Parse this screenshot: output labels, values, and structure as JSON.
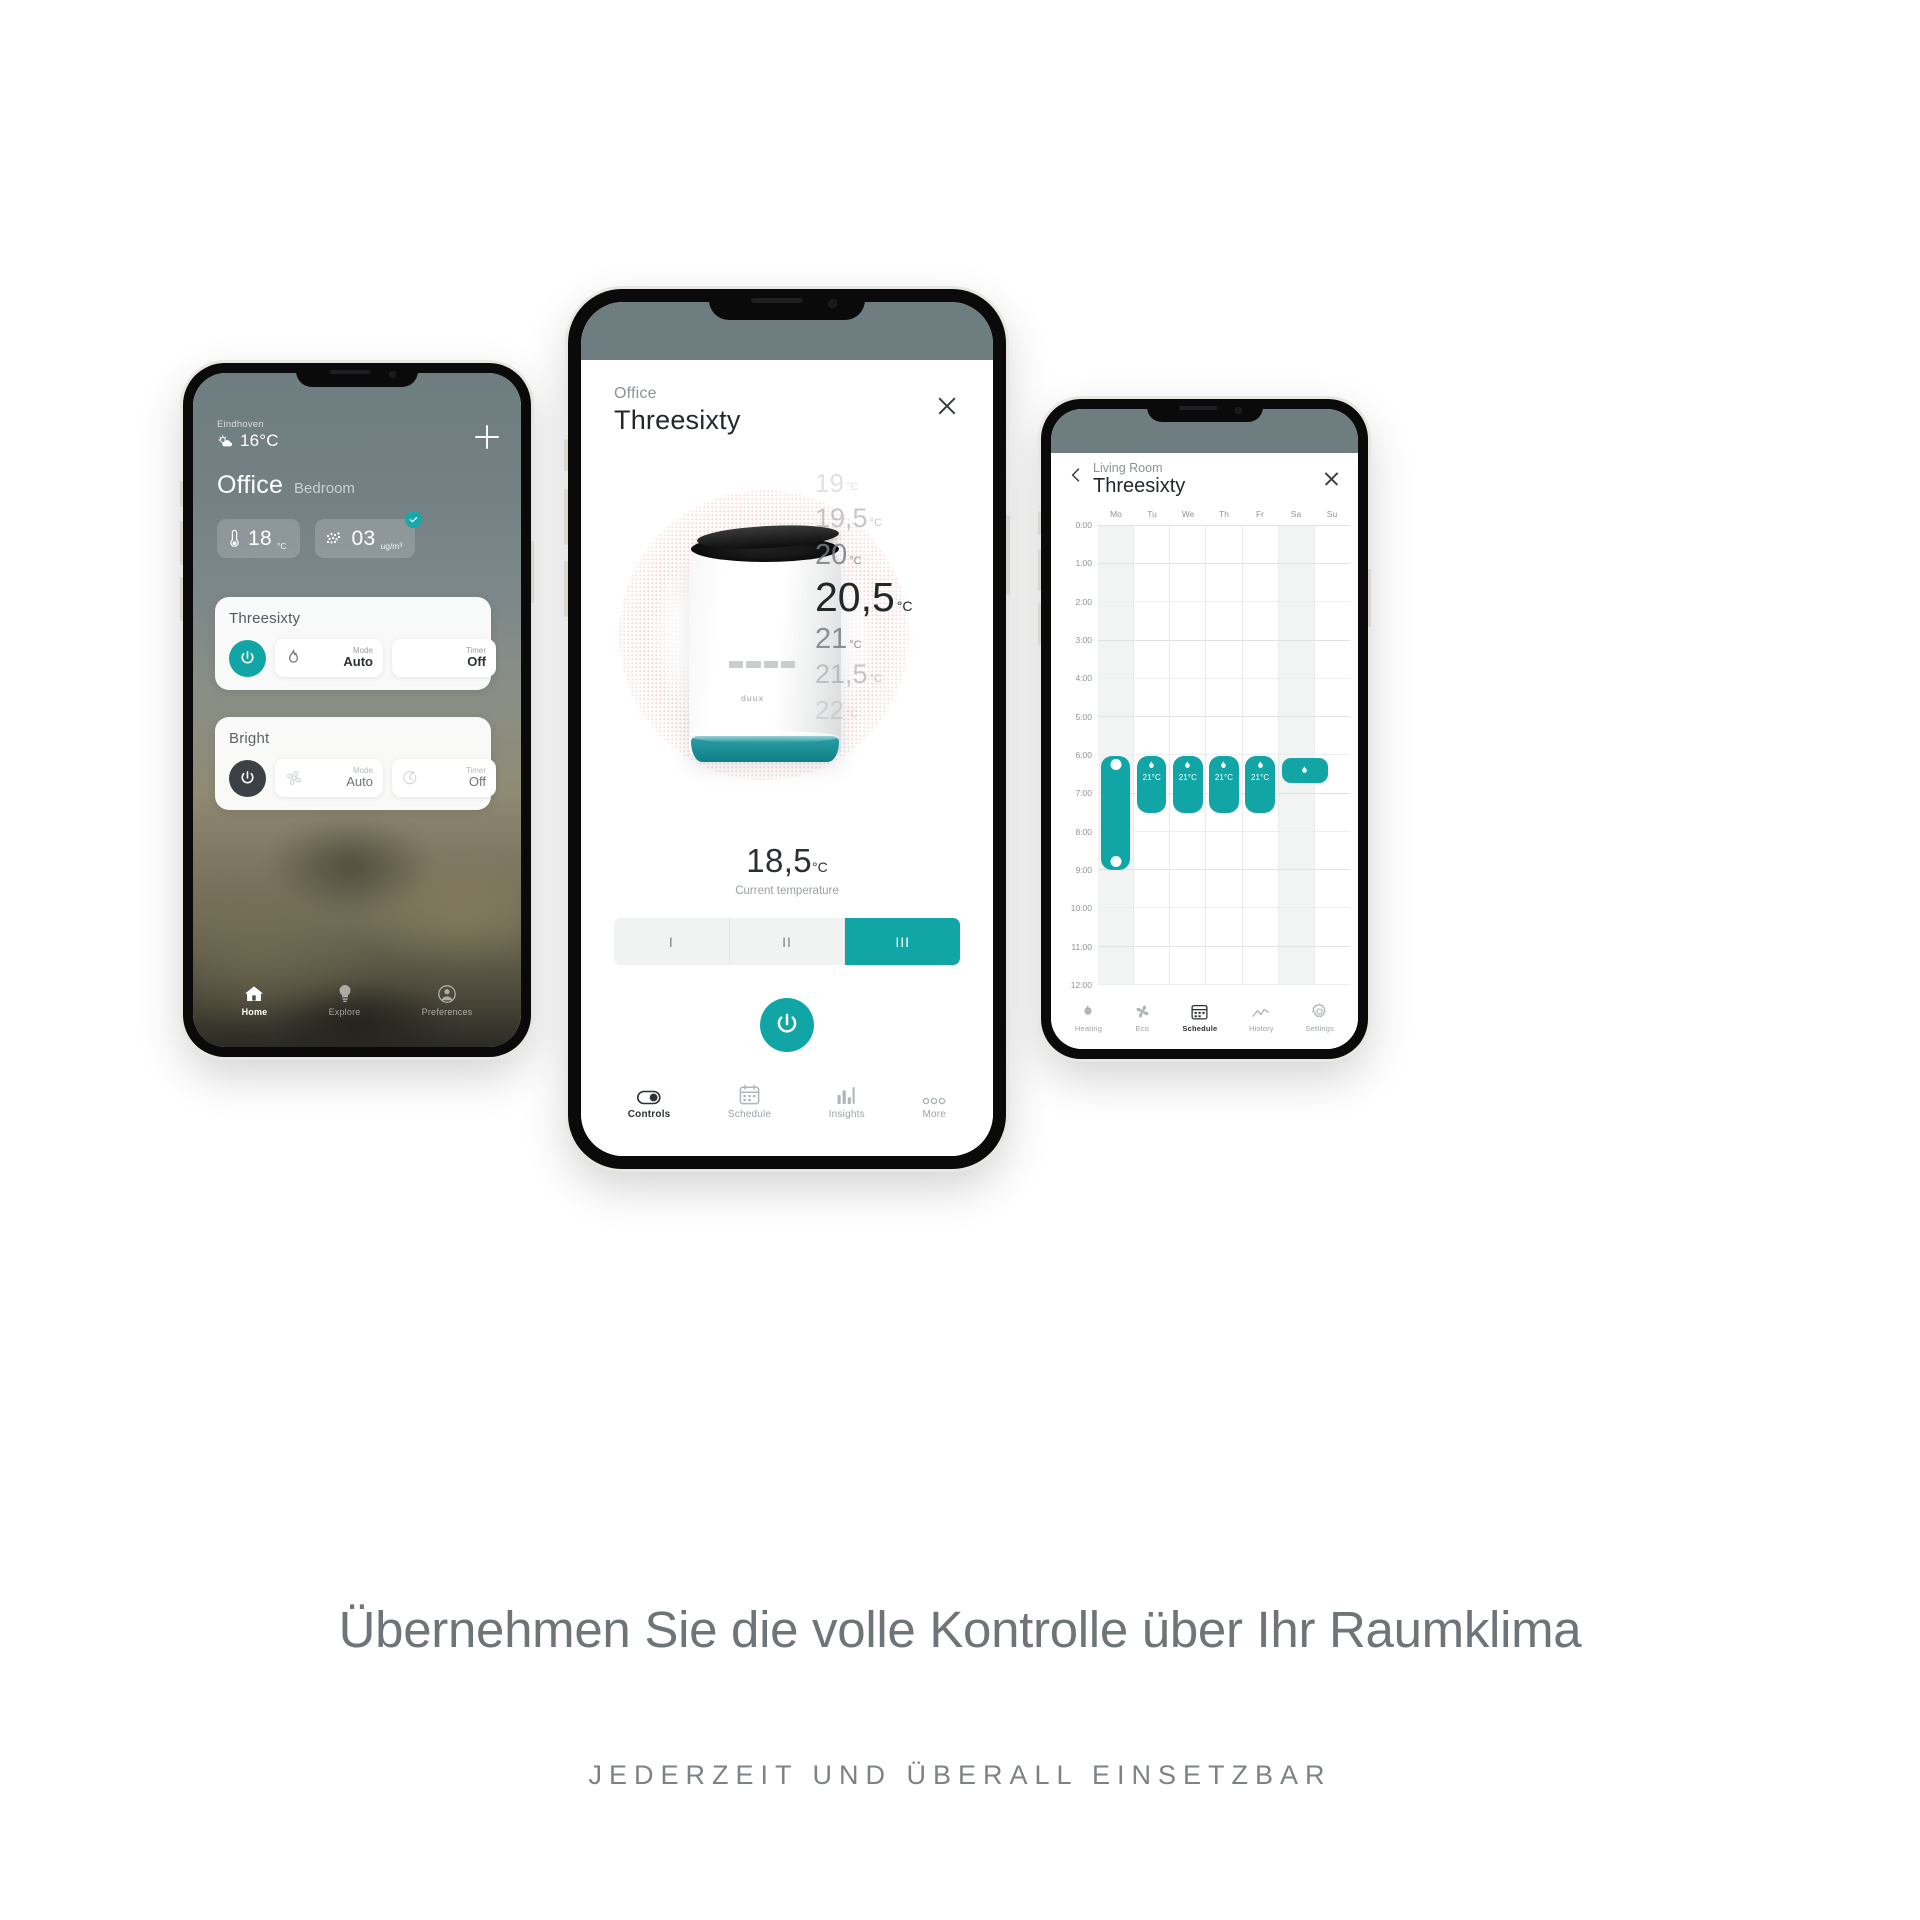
{
  "left_phone": {
    "weather": {
      "city": "Eindhoven",
      "temp": "16°C",
      "icon": "sun-cloud-icon"
    },
    "room": {
      "name": "Office",
      "alt": "Bedroom"
    },
    "add_button": "+",
    "stats": [
      {
        "icon": "thermometer-icon",
        "value": "18",
        "unit": "°C"
      },
      {
        "icon": "particles-icon",
        "value": "03",
        "unit": "ug/m³",
        "badge": "check-icon"
      }
    ],
    "cards": [
      {
        "title": "Threesixty",
        "power": "on",
        "mode": {
          "label": "Mode",
          "value": "Auto",
          "icon": "flame-icon"
        },
        "timer": {
          "label": "Timer",
          "value": "Off",
          "icon": "timer-icon"
        }
      },
      {
        "title": "Bright",
        "power": "off",
        "mode": {
          "label": "Mode",
          "value": "Auto",
          "icon": "fan-icon"
        },
        "timer": {
          "label": "Timer",
          "value": "Off",
          "icon": "timer-icon"
        }
      }
    ],
    "tabs": [
      {
        "label": "Home",
        "icon": "home-icon",
        "active": true
      },
      {
        "label": "Explore",
        "icon": "bulb-icon",
        "active": false
      },
      {
        "label": "Preferences",
        "icon": "account-icon",
        "active": false
      }
    ]
  },
  "center_phone": {
    "room": "Office",
    "title": "Threesixty",
    "close": "close-icon",
    "temperature_ladder": [
      {
        "value": "19",
        "unit": "°C",
        "state": "far"
      },
      {
        "value": "19,5",
        "unit": "°C",
        "state": "mid"
      },
      {
        "value": "20",
        "unit": "°C",
        "state": "near"
      },
      {
        "value": "20,5",
        "unit": "°C",
        "state": "selected"
      },
      {
        "value": "21",
        "unit": "°C",
        "state": "near"
      },
      {
        "value": "21,5",
        "unit": "°C",
        "state": "mid"
      },
      {
        "value": "22",
        "unit": "°C",
        "state": "far"
      }
    ],
    "device_logo": "duux",
    "current": {
      "value": "18,5",
      "unit": "°C",
      "label": "Current temperature"
    },
    "speeds": [
      {
        "label": "I",
        "active": false
      },
      {
        "label": "II",
        "active": false
      },
      {
        "label": "III",
        "active": true
      }
    ],
    "power_button": "power-icon",
    "tabs": [
      {
        "label": "Controls",
        "icon": "toggle-icon",
        "active": true
      },
      {
        "label": "Schedule",
        "icon": "calendar-icon",
        "active": false
      },
      {
        "label": "Insights",
        "icon": "bars-icon",
        "active": false
      },
      {
        "label": "More",
        "icon": "dots-icon",
        "active": false
      }
    ]
  },
  "right_phone": {
    "room": "Living Room",
    "title": "Threesixty",
    "back": "chevron-left-icon",
    "close": "close-icon",
    "tabs": [
      {
        "label": "Heating",
        "icon": "flame-icon",
        "active": false
      },
      {
        "label": "Eco",
        "icon": "fan-icon",
        "active": false
      },
      {
        "label": "Schedule",
        "icon": "calendar-icon",
        "active": true
      },
      {
        "label": "History",
        "icon": "chart-line-icon",
        "active": false
      },
      {
        "label": "Settings",
        "icon": "gear-icon",
        "active": false
      }
    ],
    "schedule": {
      "days": [
        "Mo",
        "Tu",
        "We",
        "Th",
        "Fr",
        "Sa",
        "Su"
      ],
      "times": [
        "0:00",
        "1:00",
        "2:00",
        "3:00",
        "4:00",
        "5:00",
        "6:00",
        "7:00",
        "8:00",
        "9:00",
        "10:00",
        "11:00",
        "12:00"
      ],
      "entries": [
        {
          "day": "Mo",
          "start": "6:00",
          "end": "9:00",
          "temp": "",
          "selected": true
        },
        {
          "day": "Tu",
          "start": "6:00",
          "end": "7:30",
          "temp": "21°C",
          "selected": false
        },
        {
          "day": "We",
          "start": "6:00",
          "end": "7:30",
          "temp": "21°C",
          "selected": false
        },
        {
          "day": "Th",
          "start": "6:00",
          "end": "7:30",
          "temp": "21°C",
          "selected": false
        },
        {
          "day": "Fr",
          "start": "6:00",
          "end": "7:30",
          "temp": "21°C",
          "selected": false
        },
        {
          "day": "Sa",
          "start": "6:00",
          "end": "6:40",
          "temp": "",
          "selected": false
        }
      ]
    }
  },
  "footer": {
    "headline": "Übernehmen Sie die volle Kontrolle über Ihr Raumklima",
    "subline": "JEDERZEIT UND ÜBERALL EINSETZBAR"
  },
  "colors": {
    "accent": "#12a5a5",
    "dark": "#3b4145",
    "status_bg": "#6d7d80"
  }
}
